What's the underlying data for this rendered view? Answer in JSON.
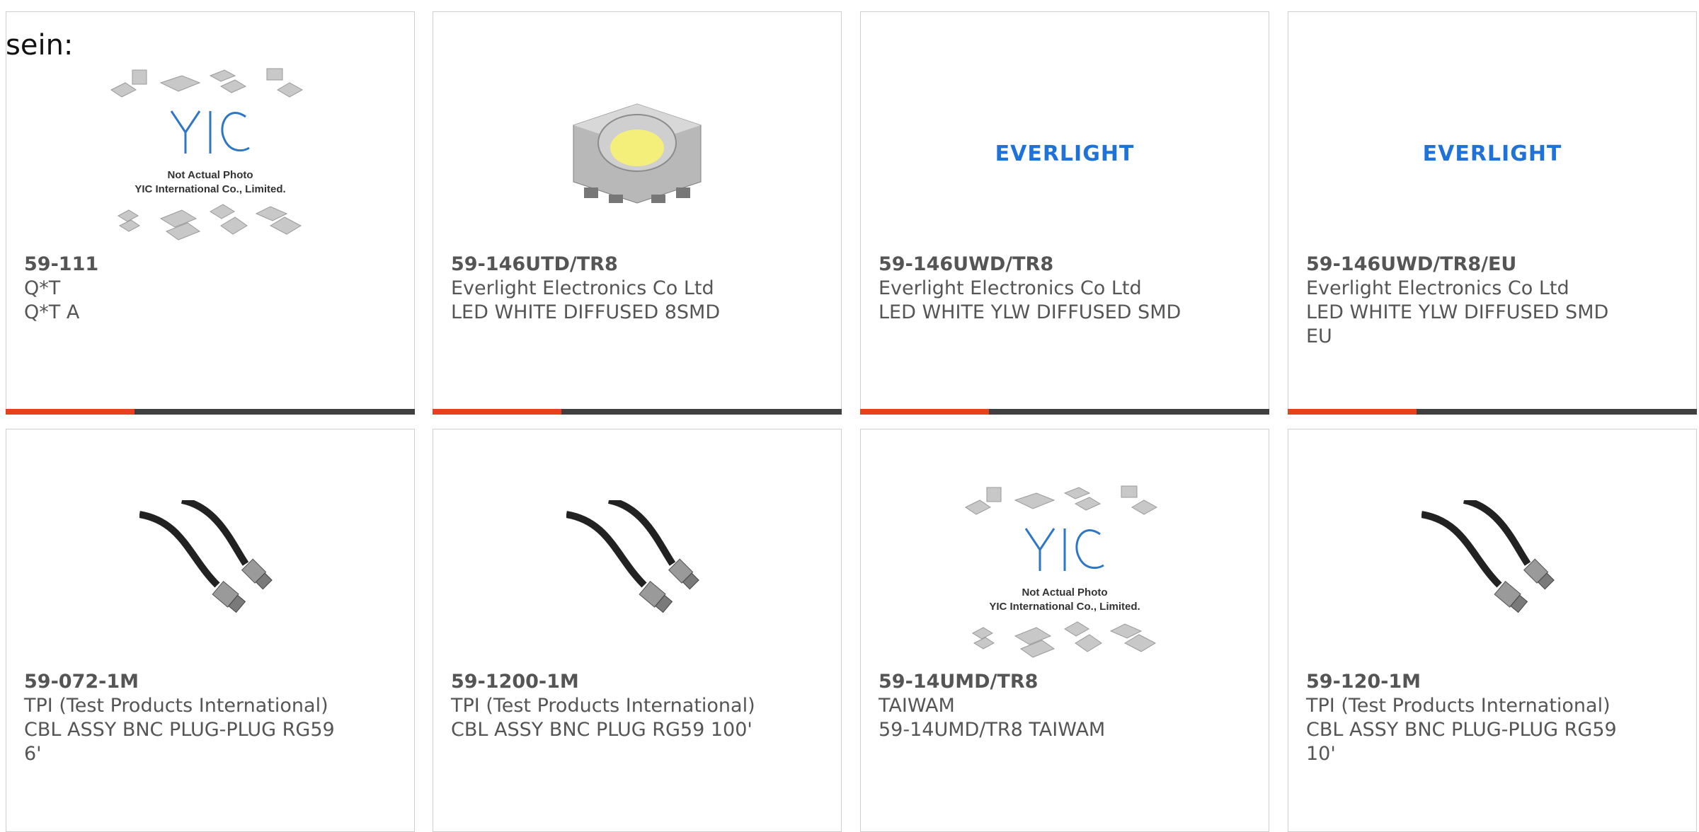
{
  "intro_text": "sein:",
  "colors": {
    "accent": "#e8401c",
    "bar": "#3f3f3f",
    "text": "#555555",
    "card_border": "#cfcfcf"
  },
  "cards": [
    {
      "part": "59-111",
      "maker": "Q*T",
      "desc": "Q*T A",
      "image": "yic-placeholder",
      "image_caption_1": "Not Actual Photo",
      "image_caption_2": "YIC International Co., Limited.",
      "logo": "YIC"
    },
    {
      "part": "59-146UTD/TR8",
      "maker": "Everlight Electronics Co Ltd",
      "desc": "LED WHITE DIFFUSED 8SMD",
      "image": "led-smd-photo"
    },
    {
      "part": "59-146UWD/TR8",
      "maker": "Everlight Electronics Co Ltd",
      "desc": "LED WHITE YLW DIFFUSED SMD",
      "image": "everlight-logo",
      "logo": "EVERLIGHT"
    },
    {
      "part": "59-146UWD/TR8/EU",
      "maker": "Everlight Electronics Co Ltd",
      "desc": "LED WHITE YLW DIFFUSED SMD EU",
      "image": "everlight-logo",
      "logo": "EVERLIGHT"
    },
    {
      "part": "59-072-1M",
      "maker": "TPI (Test Products International)",
      "desc": "CBL ASSY BNC PLUG-PLUG RG59 6'",
      "image": "bnc-cable-photo"
    },
    {
      "part": "59-1200-1M",
      "maker": "TPI (Test Products International)",
      "desc": "CBL ASSY BNC PLUG RG59 100'",
      "image": "bnc-cable-photo"
    },
    {
      "part": "59-14UMD/TR8",
      "maker": "TAIWAM",
      "desc": "59-14UMD/TR8 TAIWAM",
      "image": "yic-placeholder",
      "image_caption_1": "Not Actual Photo",
      "image_caption_2": "YIC International Co., Limited.",
      "logo": "YIC"
    },
    {
      "part": "59-120-1M",
      "maker": "TPI (Test Products International)",
      "desc": "CBL ASSY BNC PLUG-PLUG RG59 10'",
      "image": "bnc-cable-photo"
    }
  ]
}
